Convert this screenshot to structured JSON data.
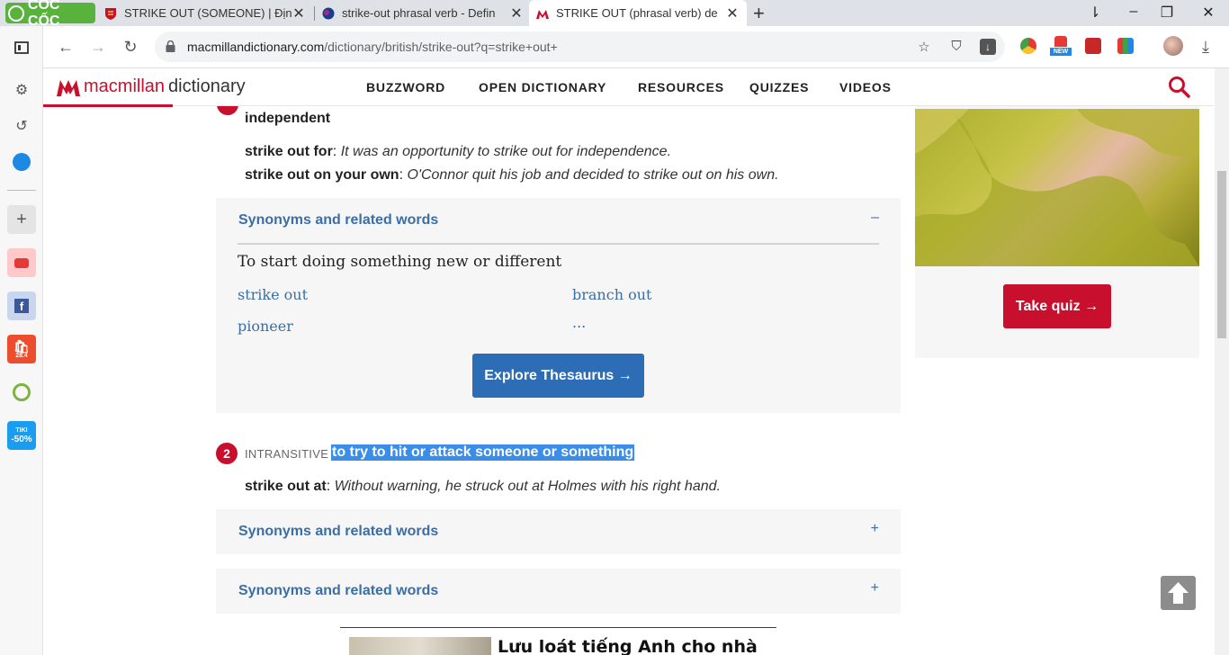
{
  "browser": {
    "brand_label": "CỐC CỐC",
    "tabs": [
      {
        "title": "STRIKE OUT (SOMEONE) | Định",
        "favicon": "cambridge-icon"
      },
      {
        "title": "strike-out phrasal verb - Defin",
        "favicon": "oxford-icon"
      },
      {
        "title": "STRIKE OUT (phrasal verb) de",
        "favicon": "macmillan-icon",
        "active": true
      }
    ],
    "new_tab_label": "+",
    "url_domain": "macmillandictionary.com",
    "url_path": "/dictionary/british/strike-out?q=strike+out+",
    "ext_new_badge": "NEW"
  },
  "sidebar": {
    "shopee_badge": "28.4",
    "tiki_label": "TIKI",
    "tiki_discount": "-50%"
  },
  "site": {
    "logo_brand": "macmillan",
    "logo_product": "dictionary",
    "nav": [
      "BUZZWORD",
      "OPEN DICTIONARY",
      "RESOURCES",
      "QUIZZES",
      "VIDEOS"
    ]
  },
  "entry": {
    "sense1_tail": "independent",
    "sense1_examples": [
      {
        "phrase": "strike out for",
        "sentence": "It was an opportunity to strike out for independence."
      },
      {
        "phrase": "strike out on your own",
        "sentence": "O'Connor quit his job and decided to strike out on his own."
      }
    ],
    "synonyms_heading": "Synonyms and related words",
    "synonyms_open_toggle": "–",
    "synonyms_closed_toggle": "+",
    "synonyms_subheading": "To start doing something new or different",
    "synonyms_words": [
      "strike out",
      "branch out",
      "pioneer",
      "..."
    ],
    "explore_button": "Explore Thesaurus →",
    "sense2": {
      "number": "2",
      "grammar": "INTRANSITIVE",
      "definition": "to try to hit or attack someone or something",
      "example_phrase": "strike out at",
      "example_sentence": "Without warning, he struck out at Holmes with his right hand."
    }
  },
  "quiz": {
    "button": "Take quiz →"
  },
  "ad": {
    "headline": "Lưu loát tiếng Anh cho nhà"
  },
  "colors": {
    "brand_red": "#c8102e",
    "link_blue": "#3a6ea5",
    "button_blue": "#2d6db5",
    "coccoc_green": "#59b23b"
  }
}
